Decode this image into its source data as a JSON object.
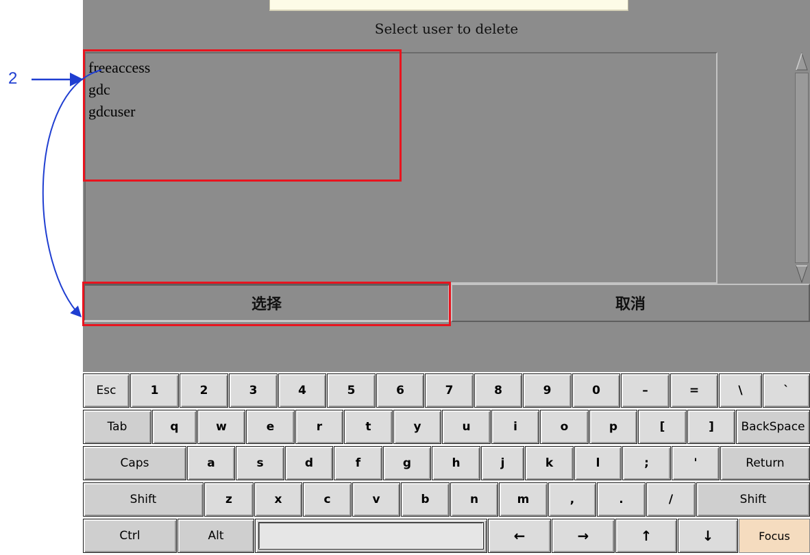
{
  "dialog": {
    "title": "Select user to delete",
    "users": [
      "freeaccess",
      "gdc",
      "gdcuser"
    ],
    "select_button": "选择",
    "cancel_button": "取消"
  },
  "annotation": {
    "label": "2",
    "color": "#1f3ed1",
    "highlight_color": "#e8141e"
  },
  "keyboard": {
    "rows": [
      [
        "Esc",
        "1",
        "2",
        "3",
        "4",
        "5",
        "6",
        "7",
        "8",
        "9",
        "0",
        "–",
        "=",
        "\\",
        "`"
      ],
      [
        "Tab",
        "q",
        "w",
        "e",
        "r",
        "t",
        "y",
        "u",
        "i",
        "o",
        "p",
        "[",
        "]",
        "BackSpace"
      ],
      [
        "Caps",
        "a",
        "s",
        "d",
        "f",
        "g",
        "h",
        "j",
        "k",
        "l",
        ";",
        "'",
        "Return"
      ],
      [
        "Shift",
        "z",
        "x",
        "c",
        "v",
        "b",
        "n",
        "m",
        ",",
        ".",
        "/",
        "Shift"
      ],
      [
        "Ctrl",
        "Alt",
        "",
        "←",
        "→",
        "↑",
        "↓",
        "Focus"
      ]
    ],
    "focus_color": "#f5dcbf"
  }
}
